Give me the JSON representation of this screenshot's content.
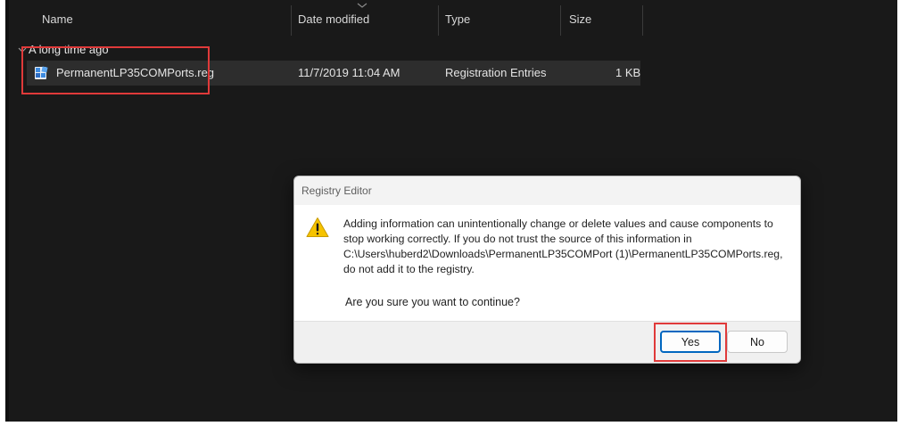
{
  "columns": {
    "name": "Name",
    "date_modified": "Date modified",
    "type": "Type",
    "size": "Size"
  },
  "group": {
    "label": "A long time ago"
  },
  "file": {
    "name": "PermanentLP35COMPorts.reg",
    "date_modified": "11/7/2019 11:04 AM",
    "type": "Registration Entries",
    "size": "1 KB",
    "icon": "registry-file-icon"
  },
  "dialog": {
    "title": "Registry Editor",
    "message": "Adding information can unintentionally change or delete values and cause components to stop working correctly. If you do not trust the source of this information in C:\\Users\\huberd2\\Downloads\\PermanentLP35COMPort (1)\\PermanentLP35COMPorts.reg, do not add it to the registry.",
    "question": "Are you sure you want to continue?",
    "yes_label": "Yes",
    "no_label": "No",
    "icon": "warning-icon"
  },
  "colors": {
    "explorer_background": "#191919",
    "highlight_annotation": "#e03a3a",
    "accent": "#0067c0",
    "warning": "#f6c300"
  }
}
